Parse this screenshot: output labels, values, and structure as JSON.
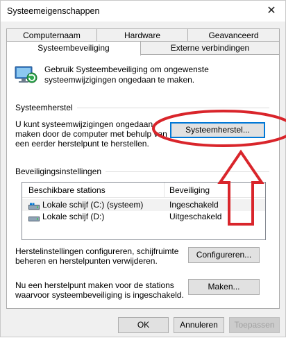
{
  "window": {
    "title": "Systeemeigenschappen",
    "close_glyph": "✕"
  },
  "tabs_top": [
    "Computernaam",
    "Hardware",
    "Geavanceerd"
  ],
  "tabs_bottom": [
    "Systeembeveiliging",
    "Externe verbindingen"
  ],
  "active_tab": "Systeembeveiliging",
  "intro": "Gebruik Systeembeveiliging om ongewenste systeemwijzigingen ongedaan te maken.",
  "restore": {
    "group_label": "Systeemherstel",
    "text": "U kunt systeemwijzigingen ongedaan maken door de computer met behulp van een eerder herstelpunt te herstellen.",
    "button_label": "Systeemherstel..."
  },
  "protection": {
    "group_label": "Beveiligingsinstellingen",
    "columns": [
      "Beschikbare stations",
      "Beveiliging"
    ],
    "drives": [
      {
        "name": "Lokale schijf (C:) (systeem)",
        "status": "Ingeschakeld",
        "icon": "system-drive-icon"
      },
      {
        "name": "Lokale schijf (D:)",
        "status": "Uitgeschakeld",
        "icon": "drive-icon"
      }
    ],
    "configure_text": "Herstelinstellingen configureren, schijfruimte beheren en herstelpunten verwijderen.",
    "configure_button": "Configureren...",
    "create_text": "Nu een herstelpunt maken voor de stations waarvoor systeembeveiliging is ingeschakeld.",
    "create_button": "Maken..."
  },
  "footer": {
    "ok": "OK",
    "cancel": "Annuleren",
    "apply": "Toepassen"
  },
  "colors": {
    "annotation_red": "#d9252b",
    "focus_blue": "#0078d7",
    "panel_bg": "#ffffff",
    "dialog_bg": "#f0f0f0"
  }
}
